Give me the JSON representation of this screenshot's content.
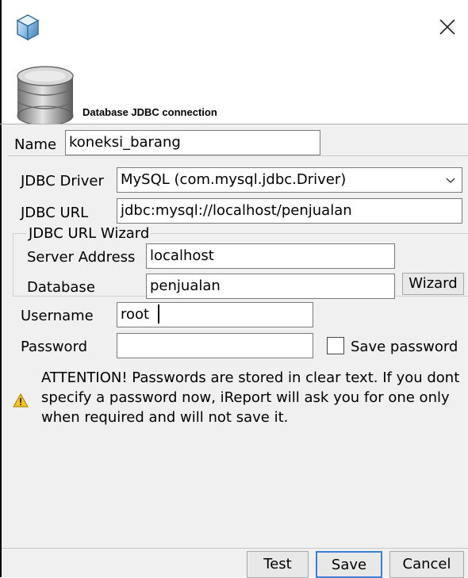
{
  "window": {
    "icon": "cube-icon",
    "close_icon": "close-icon"
  },
  "header": {
    "icon": "database-icon",
    "title": "Database JDBC connection"
  },
  "name": {
    "label": "Name",
    "value": "koneksi_barang"
  },
  "jdbc_driver": {
    "label": "JDBC Driver",
    "selected": "MySQL (com.mysql.jdbc.Driver)"
  },
  "jdbc_url": {
    "label": "JDBC URL",
    "value": "jdbc:mysql://localhost/penjualan"
  },
  "wizard": {
    "title": "JDBC URL Wizard",
    "server_label": "Server Address",
    "server_value": "localhost",
    "database_label": "Database",
    "database_value": "penjualan",
    "button_label": "Wizard"
  },
  "username": {
    "label": "Username",
    "value": "root"
  },
  "password": {
    "label": "Password",
    "value": "",
    "save_password_label": "Save password",
    "save_password_checked": false
  },
  "attention": {
    "icon": "warning-icon",
    "text": "ATTENTION! Passwords are stored in clear text. If you dont specify a password now, iReport will ask you for one only when required and will not save it."
  },
  "footer": {
    "test_label": "Test",
    "save_label": "Save",
    "cancel_label": "Cancel"
  }
}
